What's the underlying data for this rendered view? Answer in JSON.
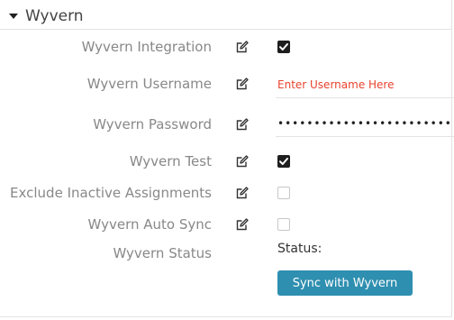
{
  "section": {
    "title": "Wyvern"
  },
  "fields": [
    {
      "label": "Wyvern Integration",
      "type": "checkbox",
      "checked": true
    },
    {
      "label": "Wyvern Username",
      "type": "text",
      "value": "",
      "placeholder": "Enter Username Here"
    },
    {
      "label": "Wyvern Password",
      "type": "password",
      "value": "•••••••••••••••••••••••••"
    },
    {
      "label": "Wyvern Test",
      "type": "checkbox",
      "checked": true
    },
    {
      "label": "Exclude Inactive Assignments",
      "type": "checkbox",
      "checked": false
    },
    {
      "label": "Wyvern Auto Sync",
      "type": "checkbox",
      "checked": false
    },
    {
      "label": "Wyvern Status",
      "type": "status"
    }
  ],
  "status": {
    "text": "Status:"
  },
  "sync_button": {
    "label": "Sync with Wyvern"
  },
  "colors": {
    "accent": "#2f8fb0",
    "placeholder": "#e8432e",
    "label": "#888888"
  },
  "icons": {
    "edit": "edit-icon",
    "caret": "caret-down-icon"
  }
}
